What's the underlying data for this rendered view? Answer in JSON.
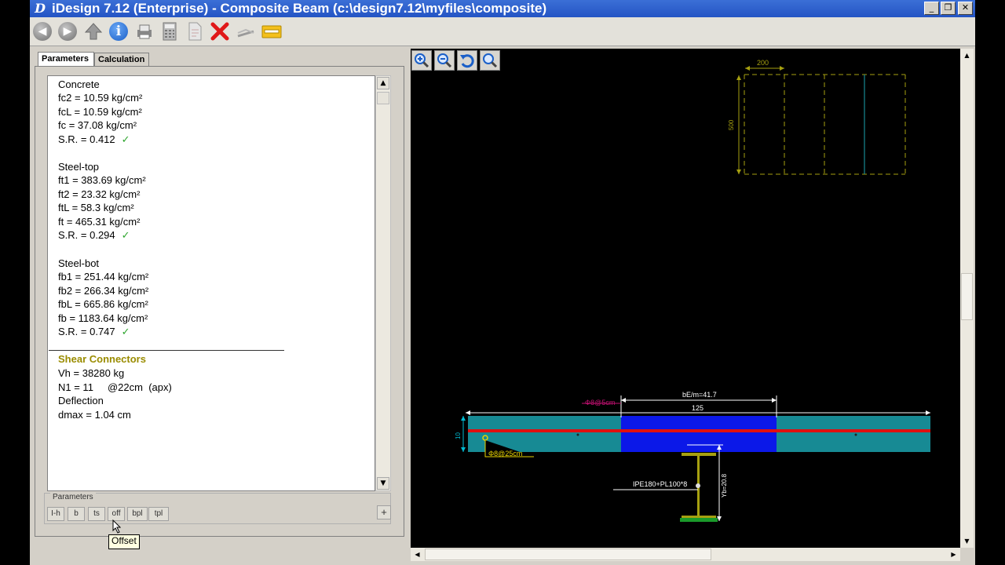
{
  "window": {
    "title": "iDesign 7.12 (Enterprise) - Composite Beam (c:\\design7.12\\myfiles\\composite)",
    "app_icon": "D"
  },
  "toolbar": {
    "icons": [
      "back-icon",
      "forward-icon",
      "up-icon",
      "info-icon",
      "print-icon",
      "calculator-icon",
      "document-icon",
      "delete-icon",
      "sign-icon",
      "folder-icon"
    ]
  },
  "tabs": [
    {
      "label": "Parameters",
      "active": true
    },
    {
      "label": "Calculation",
      "active": false
    }
  ],
  "results": {
    "concrete": {
      "heading": "Concrete",
      "lines": [
        "fc2 = 10.59 kg/cm²",
        "fcL = 10.59 kg/cm²",
        "fc = 37.08 kg/cm²"
      ],
      "sr": "S.R. = 0.412",
      "check": "✓"
    },
    "steel_top": {
      "heading": "Steel-top",
      "lines": [
        "ft1 = 383.69 kg/cm²",
        "ft2 = 23.32 kg/cm²",
        "ftL = 58.3 kg/cm²",
        "ft = 465.31 kg/cm²"
      ],
      "sr": "S.R. = 0.294",
      "check": "✓"
    },
    "steel_bot": {
      "heading": "Steel-bot",
      "lines": [
        "fb1 = 251.44 kg/cm²",
        "fb2 = 266.34 kg/cm²",
        "fbL = 665.86 kg/cm²",
        "fb = 1183.64 kg/cm²"
      ],
      "sr": "S.R. = 0.747",
      "check": "✓"
    },
    "shear": {
      "heading": "Shear Connectors",
      "vh": "Vh = 38280 kg",
      "n1": "N1 = 11     @22cm  (apx)",
      "deflection": "Deflection",
      "dmax": "dmax = 1.04 cm"
    }
  },
  "parameters": {
    "label": "Parameters",
    "buttons": [
      "I-h",
      "b",
      "ts",
      "off",
      "bpl",
      "tpl"
    ],
    "plus": "+",
    "tooltip": "Offset"
  },
  "drawing": {
    "top_width": "200",
    "top_height": "500",
    "be": "bE/m=41.7",
    "span": "125",
    "rebar_top": "Φ8@5cm",
    "slab_thk": "10",
    "rebar_bot": "Φ8@25cm",
    "section": "IPE180+PL100*8",
    "yb": "Yb=20.8"
  },
  "colors": {
    "title_bar": "#2454c4",
    "slab": "#178a94",
    "effective_width": "#0b18e8",
    "rebar": "#e01010",
    "beam": "#a6a010"
  }
}
